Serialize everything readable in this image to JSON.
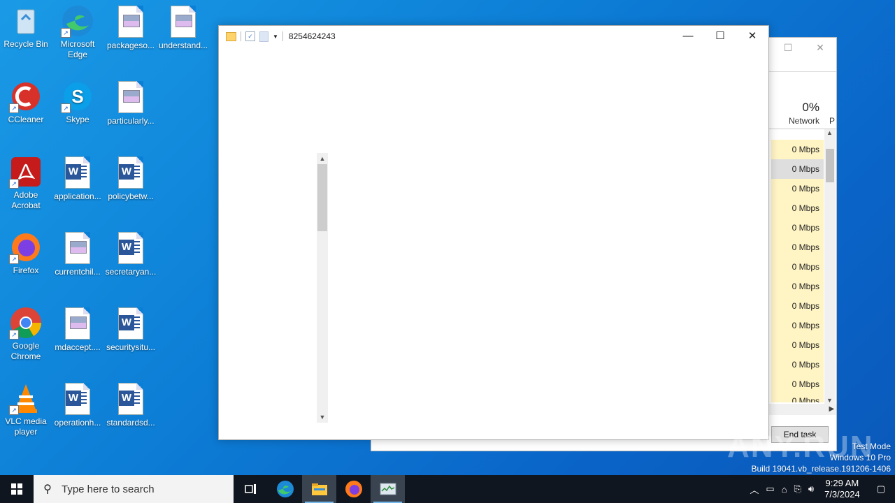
{
  "desktop": {
    "icons": [
      {
        "label": "Recycle Bin"
      },
      {
        "label": "Microsoft Edge"
      },
      {
        "label": "packageso..."
      },
      {
        "label": "understand..."
      },
      {
        "label": "CCleaner"
      },
      {
        "label": "Skype"
      },
      {
        "label": "particularly..."
      },
      {
        "label": "Adobe Acrobat"
      },
      {
        "label": "application..."
      },
      {
        "label": "policybetw..."
      },
      {
        "label": "Firefox"
      },
      {
        "label": "currentchil..."
      },
      {
        "label": "secretaryan..."
      },
      {
        "label": "Google Chrome"
      },
      {
        "label": "mdaccept...."
      },
      {
        "label": "securitysitu..."
      },
      {
        "label": "VLC media player"
      },
      {
        "label": "operationh..."
      },
      {
        "label": "standardsd..."
      }
    ]
  },
  "explorer": {
    "title": "8254624243",
    "controls": {
      "minimize": "—",
      "maximize": "☐",
      "close": "✕"
    }
  },
  "taskmgr": {
    "network_pct": "0%",
    "network_label": "Network",
    "next_col_label": "P",
    "rows": [
      "0 Mbps",
      "0 Mbps",
      "0 Mbps",
      "0 Mbps",
      "0 Mbps",
      "0 Mbps",
      "0 Mbps",
      "0 Mbps",
      "0 Mbps",
      "0 Mbps",
      "0 Mbps",
      "0 Mbps",
      "0 Mbps",
      "0 Mbps"
    ],
    "end_task": "End task"
  },
  "watermark": {
    "line1": "Test Mode",
    "line2": "Windows 10 Pro",
    "line3": "Build 19041.vb_release.191206-1406",
    "brand": "ANY.RUN"
  },
  "taskbar": {
    "search_placeholder": "Type here to search",
    "time": "9:29 AM",
    "date": "7/3/2024"
  }
}
